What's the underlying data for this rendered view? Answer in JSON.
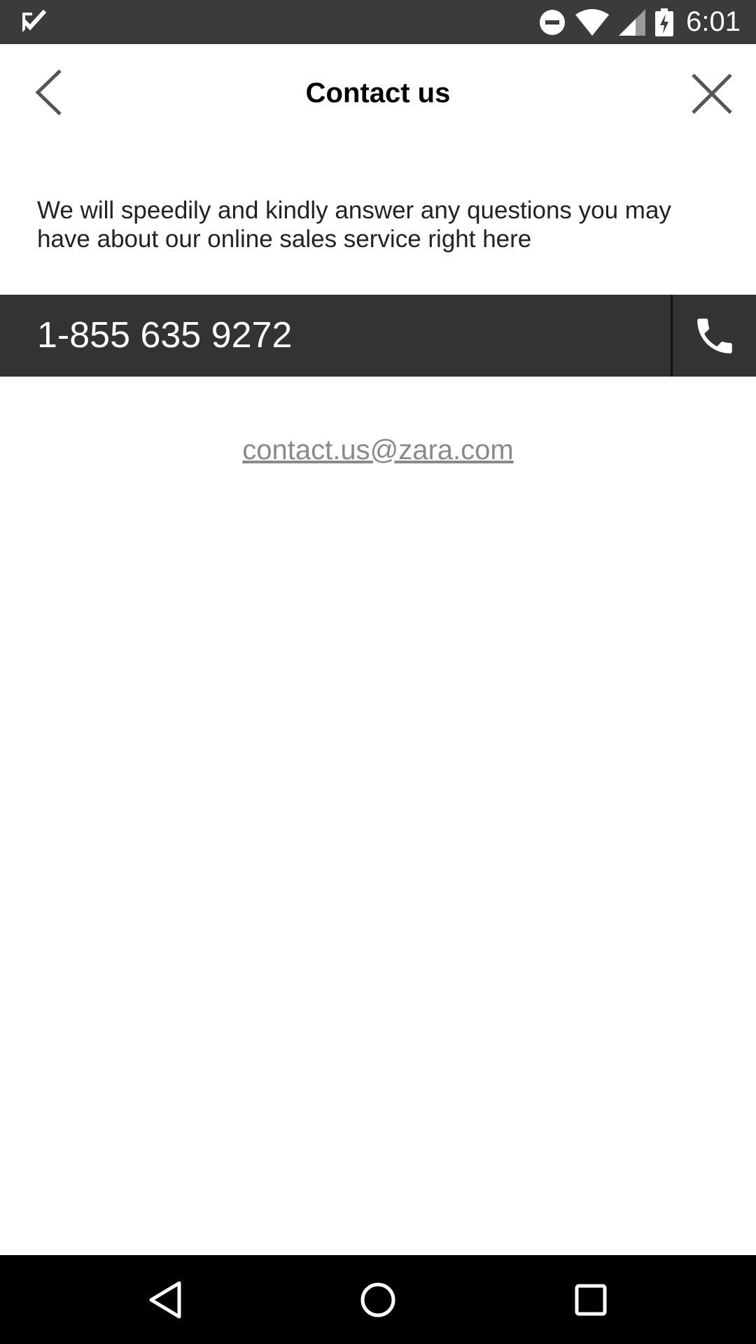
{
  "status_bar": {
    "time": "6:01",
    "icons": [
      "notification-check-icon",
      "do-not-disturb-icon",
      "wifi-icon",
      "cell-signal-icon",
      "battery-charging-icon"
    ]
  },
  "header": {
    "title": "Contact us",
    "back_icon": "chevron-left-icon",
    "close_icon": "close-icon"
  },
  "description": "We will speedily and kindly answer any questions you may have about our online sales service right here",
  "phone": {
    "number": "1-855 635 9272",
    "call_icon": "phone-icon"
  },
  "email": "contact.us@zara.com",
  "nav_bar": {
    "icons": [
      "nav-back-icon",
      "nav-home-icon",
      "nav-recents-icon"
    ]
  },
  "colors": {
    "status_bar_bg": "#3b3b3b",
    "phone_bar_bg": "#333333",
    "email_text": "#8a8a8a",
    "nav_bar_bg": "#000000"
  }
}
